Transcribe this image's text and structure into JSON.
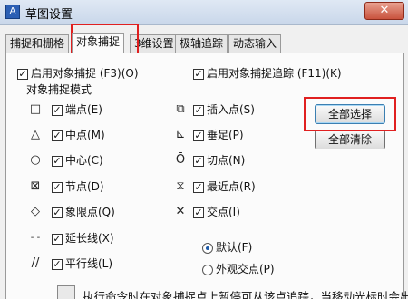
{
  "window": {
    "title": "草图设置",
    "close_label": "✕"
  },
  "tabs": [
    {
      "label": "捕捉和栅格"
    },
    {
      "label": "对象捕捉"
    },
    {
      "label": "3维设置"
    },
    {
      "label": "极轴追踪"
    },
    {
      "label": "动态输入"
    }
  ],
  "osnap": {
    "enable_label": "启用对象捕捉 (F3)(O)",
    "tracking_label": "启用对象捕捉追踪 (F11)(K)",
    "modes_label": "对象捕捉模式",
    "left_items": [
      {
        "label": "端点(E)",
        "icon": "square-icon",
        "glyph": "□"
      },
      {
        "label": "中点(M)",
        "icon": "triangle-icon",
        "glyph": "△"
      },
      {
        "label": "中心(C)",
        "icon": "circle-icon",
        "glyph": "○"
      },
      {
        "label": "节点(D)",
        "icon": "circle-x-icon",
        "glyph": "⊠"
      },
      {
        "label": "象限点(Q)",
        "icon": "diamond-icon",
        "glyph": "◇"
      },
      {
        "label": "延长线(X)",
        "icon": "dash-icon",
        "glyph": "- -"
      },
      {
        "label": "平行线(L)",
        "icon": "parallel-icon",
        "glyph": "//"
      }
    ],
    "right_items": [
      {
        "label": "插入点(S)",
        "icon": "insert-icon",
        "glyph": "⧉"
      },
      {
        "label": "垂足(P)",
        "icon": "perpendicular-icon",
        "glyph": "⊾"
      },
      {
        "label": "切点(N)",
        "icon": "tangent-icon",
        "glyph": "Ō"
      },
      {
        "label": "最近点(R)",
        "icon": "hourglass-icon",
        "glyph": "⧖"
      },
      {
        "label": "交点(I)",
        "icon": "cross-icon",
        "glyph": "✕"
      }
    ],
    "radio_default": "默认(F)",
    "radio_apparent": "外观交点(P)",
    "select_all": "全部选择",
    "clear_all": "全部清除",
    "hint_text": "执行命令时在对象捕捉点上暂停可从该点追踪，当移动光标时会出"
  }
}
